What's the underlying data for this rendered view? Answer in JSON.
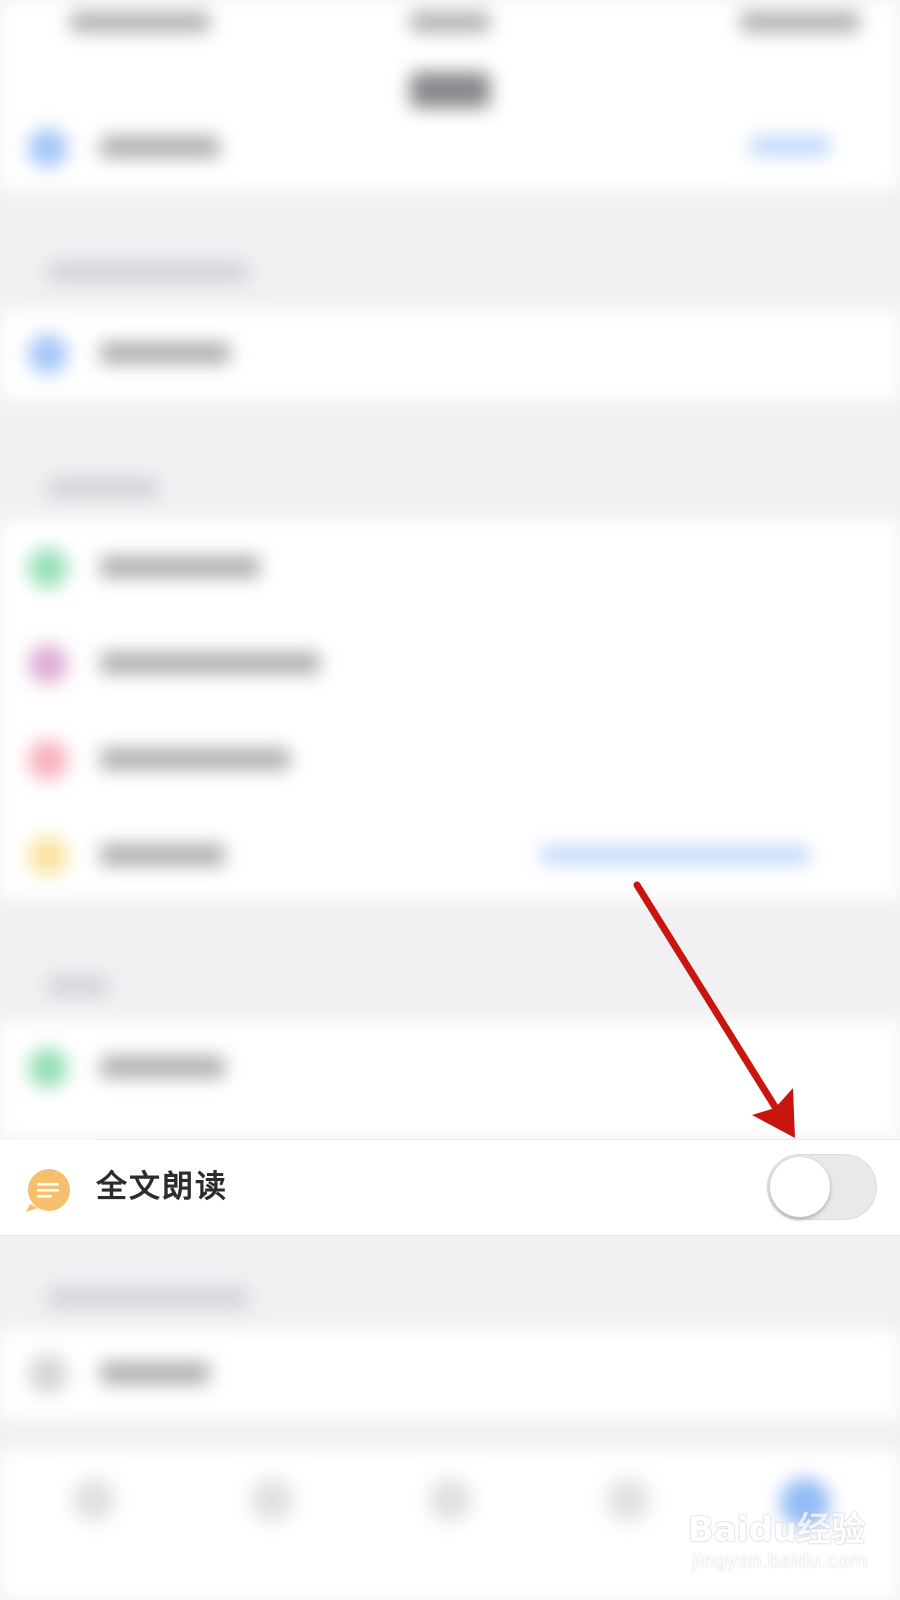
{
  "setting_row": {
    "icon": "chat-bubble-icon",
    "label": "全文朗读",
    "toggle_on": false
  },
  "colors": {
    "icon_accent": "#f5bf6c",
    "annotation_arrow": "#c8160f",
    "toggle_off_track": "#e9e9ec"
  },
  "annotation": {
    "type": "arrow",
    "target": "toggle"
  },
  "watermark": {
    "brand": "Baidu经验",
    "url": "jingyan.baidu.com"
  }
}
